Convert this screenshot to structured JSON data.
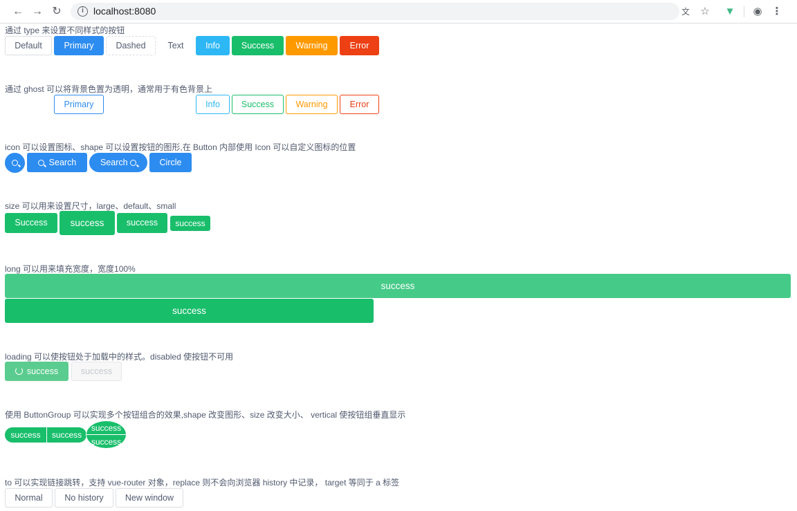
{
  "browser": {
    "url": "localhost:8080",
    "back_icon": "back-arrow-icon",
    "forward_icon": "forward-arrow-icon",
    "reload_icon": "reload-icon"
  },
  "sections": {
    "type": {
      "label": "通过 type 来设置不同样式的按钮",
      "buttons": [
        "Default",
        "Primary",
        "Dashed",
        "Text",
        "Info",
        "Success",
        "Warning",
        "Error"
      ]
    },
    "ghost": {
      "label": "通过 ghost 可以将背景色置为透明，通常用于有色背景上",
      "buttons": [
        "Primary",
        "Info",
        "Success",
        "Warning",
        "Error"
      ]
    },
    "icon": {
      "label": "icon 可以设置图标、shape 可以设置按钮的图形,在 Button 内部使用 Icon 可以自定义图标的位置",
      "buttons": [
        "Search",
        "Search",
        "Circle"
      ]
    },
    "size": {
      "label": "size 可以用来设置尺寸，large、default、small",
      "buttons": [
        "Success",
        "success",
        "success",
        "success"
      ]
    },
    "long": {
      "label": "long 可以用来填充宽度，宽度100%",
      "buttons": [
        "success",
        "success"
      ]
    },
    "loading": {
      "label": "loading 可以使按钮处于加载中的样式。disabled 使按钮不可用",
      "buttons": [
        "success",
        "success"
      ]
    },
    "group": {
      "label": "使用 ButtonGroup 可以实现多个按钮组合的效果,shape 改变图形、size 改变大小、 vertical 使按钮组垂直显示",
      "buttons": [
        "success",
        "success",
        "success",
        "success"
      ]
    },
    "to": {
      "label": "to 可以实现链接跳转，支持 vue-router 对象，replace 则不会向浏览器 history 中记录， target 等同于 a 标签",
      "buttons": [
        "Normal",
        "No history",
        "New window"
      ]
    }
  },
  "colors": {
    "primary": "#2d8cf0",
    "info": "#2db7f5",
    "success": "#19be6b",
    "warning": "#ff9900",
    "error": "#ed4014"
  }
}
